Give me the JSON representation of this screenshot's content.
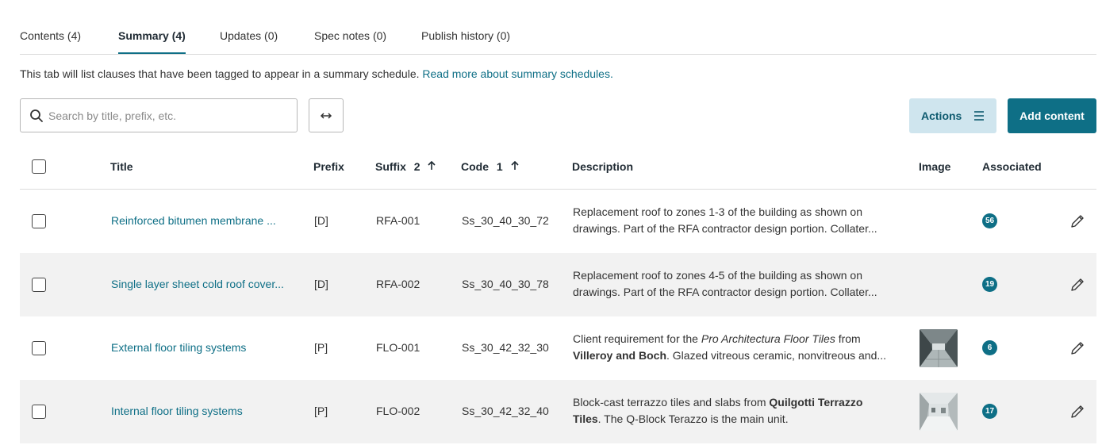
{
  "tabs": [
    {
      "label": "Contents (4)"
    },
    {
      "label": "Summary (4)"
    },
    {
      "label": "Updates (0)"
    },
    {
      "label": "Spec notes (0)"
    },
    {
      "label": "Publish history (0)"
    }
  ],
  "intro": {
    "text": "This tab will list clauses that have been tagged to appear in a summary schedule. ",
    "link": "Read more about summary schedules."
  },
  "search": {
    "placeholder": "Search by title, prefix, etc."
  },
  "toolbar": {
    "actions_label": "Actions",
    "add_label": "Add content"
  },
  "colors": {
    "accent": "#0e6f86",
    "actions_bg": "#cfe5ee",
    "row_alt": "#f2f2f2"
  },
  "table": {
    "headers": {
      "title": "Title",
      "prefix": "Prefix",
      "suffix": "Suffix",
      "suffix_sort": "2",
      "code": "Code",
      "code_sort": "1",
      "description": "Description",
      "image": "Image",
      "associated": "Associated"
    },
    "rows": [
      {
        "title": "Reinforced bitumen membrane ...",
        "prefix": "[D]",
        "suffix": "RFA-001",
        "code": "Ss_30_40_30_72",
        "desc1": "Replacement roof to zones 1-3 of the building as shown on",
        "desc2": "drawings. Part of the RFA contractor design portion. Collater...",
        "associated": "56"
      },
      {
        "title": "Single layer sheet cold roof cover...",
        "prefix": "[D]",
        "suffix": "RFA-002",
        "code": "Ss_30_40_30_78",
        "desc1": "Replacement roof to zones 4-5 of the building as shown on",
        "desc2": "drawings. Part of the RFA contractor design portion. Collater...",
        "associated": "19"
      },
      {
        "title": "External floor tiling systems",
        "prefix": "[P]",
        "suffix": "FLO-001",
        "code": "Ss_30_42_32_30",
        "desc1a": "Client requirement for the ",
        "desc1b": "Pro Architectura Floor Tiles",
        "desc1c": " from",
        "desc2a": "Villeroy and Boch",
        "desc2b": ". Glazed vitreous ceramic, nonvitreous and...",
        "associated": "6"
      },
      {
        "title": "Internal floor tiling systems",
        "prefix": "[P]",
        "suffix": "FLO-002",
        "code": "Ss_30_42_32_40",
        "desc1a": "Block-cast terrazzo tiles and slabs from ",
        "desc1b": "Quilgotti Terrazzo",
        "desc2a": "Tiles",
        "desc2b": ". The Q-Block Terazzo is the main unit.",
        "associated": "17"
      }
    ]
  }
}
